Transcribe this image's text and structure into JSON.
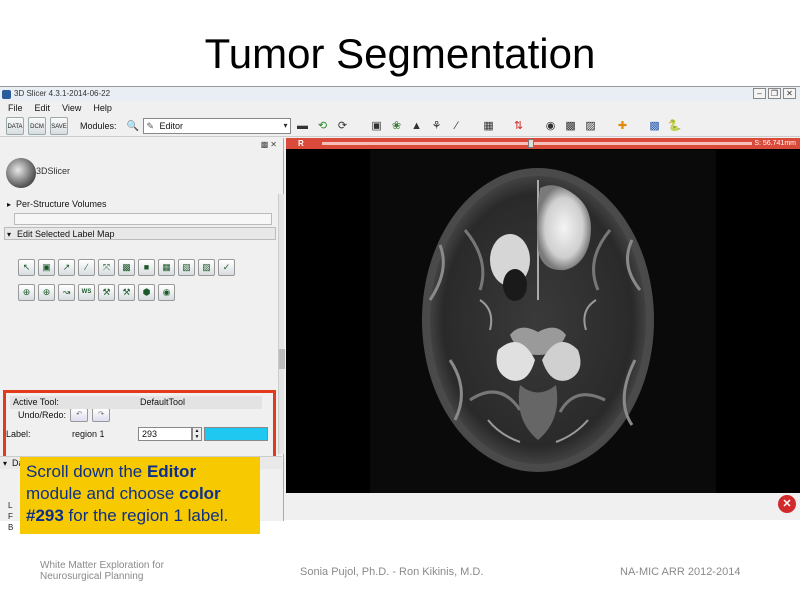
{
  "slide": {
    "title": "Tumor Segmentation",
    "footer_left_line1": "White Matter Exploration for",
    "footer_left_line2": "Neurosurgical Planning",
    "footer_center": "Sonia Pujol, Ph.D. - Ron Kikinis, M.D.",
    "footer_right": "NA-MIC ARR 2012-2014"
  },
  "window": {
    "title": "3D Slicer 4.3.1-2014-06-22",
    "controls": [
      "–",
      "❐",
      "✕"
    ]
  },
  "menubar": [
    "File",
    "Edit",
    "View",
    "Help"
  ],
  "toolbar": {
    "buttons": [
      "DATA",
      "DCM",
      "SAVE"
    ],
    "modules_label": "Modules:",
    "module_selected": "Editor"
  },
  "left_panel": {
    "logo_text": "3DSlicer",
    "per_structure": "Per-Structure Volumes",
    "edit_label_map": "Edit Selected Label Map",
    "tool_row1": [
      "↖",
      "▣",
      "↗",
      "∕",
      "⤧",
      "▩",
      "■",
      "▦",
      "▧",
      "▨",
      "✓"
    ],
    "tool_row2": [
      "⊕",
      "⊕",
      "↝",
      "WS",
      "⚒",
      "⚒",
      "⬢",
      "◉"
    ],
    "undo_redo_label": "Undo/Redo:",
    "undo_glyph": "↶",
    "redo_glyph": "↷",
    "active_tool_label": "Active Tool:",
    "active_tool_value": "DefaultTool",
    "label_label": "Label:",
    "label_name": "region 1",
    "label_value": "293",
    "label_color": "#1ec8f0",
    "data_probe": "Data Probe",
    "probe_letters": [
      "L",
      "F",
      "B"
    ]
  },
  "viewer": {
    "view_name": "R",
    "slice_offset": "S: 56.741mm",
    "accent_color": "#d94a3a"
  },
  "callout": {
    "p1": "Scroll down the ",
    "b1": "Editor",
    "p2": " module and choose ",
    "b2": "color #293",
    "p3": " for the region 1 label."
  }
}
